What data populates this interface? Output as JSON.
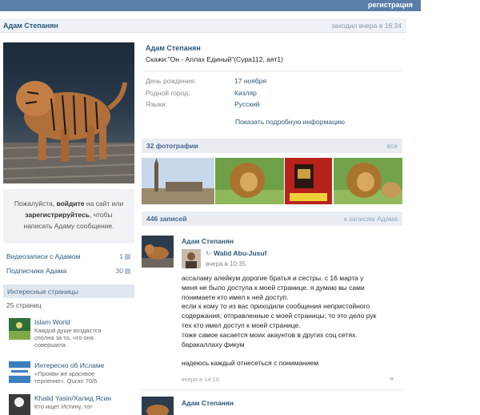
{
  "header": {
    "register_link": "регистрация"
  },
  "profile": {
    "name": "Адам Степанян",
    "last_seen": "заходил вчера в 16:34",
    "status": "Скажи:\"Он - Аллах Единый\"(Сура112, аят1)",
    "fields": [
      {
        "label": "День рождения:",
        "value": "17 ноября"
      },
      {
        "label": "Родной город:",
        "value": "Кизляр"
      },
      {
        "label": "Языки:",
        "value": "Русский"
      }
    ],
    "show_more": "Показать подробную информацию"
  },
  "login_prompt": {
    "line1_pre": "Пожалуйста, ",
    "line1_bold": "войдите",
    "line1_post": " на сайт или",
    "line2_bold": "зарегистрируйтесь",
    "line2_post": ", чтобы",
    "line3": "написать Адаму сообщение."
  },
  "sidebar": {
    "videos": {
      "label": "Видеозаписи с Адамом",
      "count": "1"
    },
    "subscriptions": {
      "label": "Подписчики Адама",
      "count": "30"
    },
    "interesting_title": "Интересные страницы",
    "pages_count": "25 страниц",
    "pages": [
      {
        "title": "Islam World",
        "desc": "Каждой душе воздастся сполна за то, что она совершила"
      },
      {
        "title": "Интересно об Исламе",
        "desc": "«Прояви же красивое терпение». Quran 70/5"
      },
      {
        "title": "Khalid Yasin/Халид Ясин",
        "desc": "Кто ищет Истину, тот"
      }
    ]
  },
  "photos": {
    "title": "32 фотографии",
    "all_link": "все"
  },
  "wall": {
    "title": "446 записей",
    "link": "к записям Адама",
    "post": {
      "author": "Адам Степанян",
      "repost_author": "Walid Abu-Jusuf",
      "repost_time": "вчера в 10:35",
      "text_lines": [
        "ассаламу алейкум дорогие братья и сестры. с 16 марта у",
        "меня не было доступа к моей странице. я думаю вы сами",
        "понимаете кто имел к ней доступ.",
        "если к кому то из вас приходили сообщения непристойного",
        "содержания; отправленные с моей страницы; то это дело рук",
        "тех кто имел доступ к моей странице.",
        "тоже самое касается моих акаунтов в других соц сетях.",
        "баракаллаху фикум",
        "",
        "надеюсь каждый отнесеться с пониманием"
      ],
      "time": "вчера в 14:18"
    },
    "next_author": "Адам Степанян"
  },
  "colors": {
    "link": "#2b587a",
    "topbar": "#5a7fa6",
    "band": "#e9edf1"
  }
}
